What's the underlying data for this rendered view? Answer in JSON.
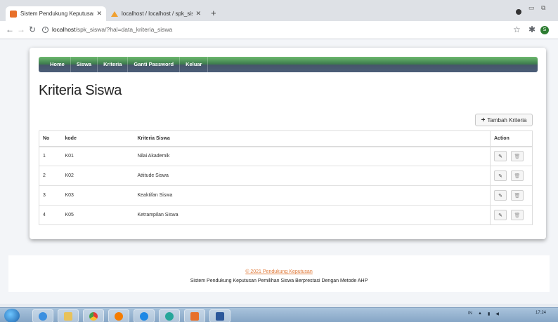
{
  "browser": {
    "tabs": [
      {
        "title": "Sistem Pendukung Keputusan Pe",
        "close": "✕"
      },
      {
        "title": "localhost / localhost / spk_siswa",
        "close": "✕"
      }
    ],
    "new_tab": "+",
    "url_host": "localhost",
    "url_path": "/spk_siswa/?hal=data_kriteria_siswa",
    "profile_initial": "S"
  },
  "navbar": {
    "items": [
      "Home",
      "Siswa",
      "Kriteria",
      "Ganti Password",
      "Keluar"
    ]
  },
  "page": {
    "title": "Kriteria Siswa",
    "add_button_label": "Tambah Kriteria"
  },
  "table": {
    "headers": [
      "No",
      "kode",
      "Kriteria Siswa",
      "Action"
    ],
    "rows": [
      {
        "no": "1",
        "kode": "K01",
        "kriteria": "Nilai Akademik"
      },
      {
        "no": "2",
        "kode": "K02",
        "kriteria": "Attitude Siswa"
      },
      {
        "no": "3",
        "kode": "K03",
        "kriteria": "Keaktifan Siswa"
      },
      {
        "no": "4",
        "kode": "K05",
        "kriteria": "Ketrampilan Siswa"
      }
    ]
  },
  "footer": {
    "copyright": "© 2021 Pendukung Keputusan",
    "subtitle": "Sistem Pendukung Keputusan Pemilihan Siswa Berprestasi Dengan Metode AHP"
  },
  "taskbar": {
    "clock_time": "17:24",
    "tray_lang": "IN"
  },
  "colors": {
    "navbar_top": "#6cb86d",
    "navbar_bottom": "#4b5d78",
    "footer_link": "#e07a3a",
    "profile": "#2e7d32"
  }
}
